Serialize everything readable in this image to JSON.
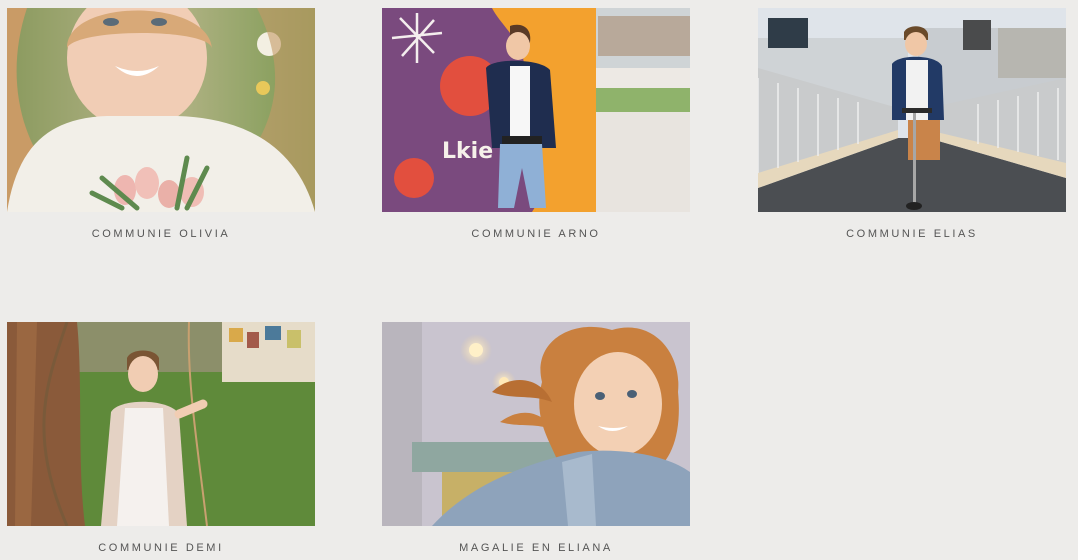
{
  "gallery": {
    "items": [
      {
        "title": "COMMUNIE OLIVIA",
        "photo": "portrait-girl-with-tulips"
      },
      {
        "title": "COMMUNIE ARNO",
        "photo": "boy-leaning-on-graffiti-wall"
      },
      {
        "title": "COMMUNIE ELIAS",
        "photo": "boy-on-scooter-bridge"
      },
      {
        "title": "COMMUNIE DEMI",
        "photo": "girl-holding-rope-by-tree"
      },
      {
        "title": "MAGALIE EN ELIANA",
        "photo": "girl-with-flying-hair-denim-jacket"
      }
    ]
  },
  "colors": {
    "background": "#edecea",
    "caption": "#555555"
  }
}
